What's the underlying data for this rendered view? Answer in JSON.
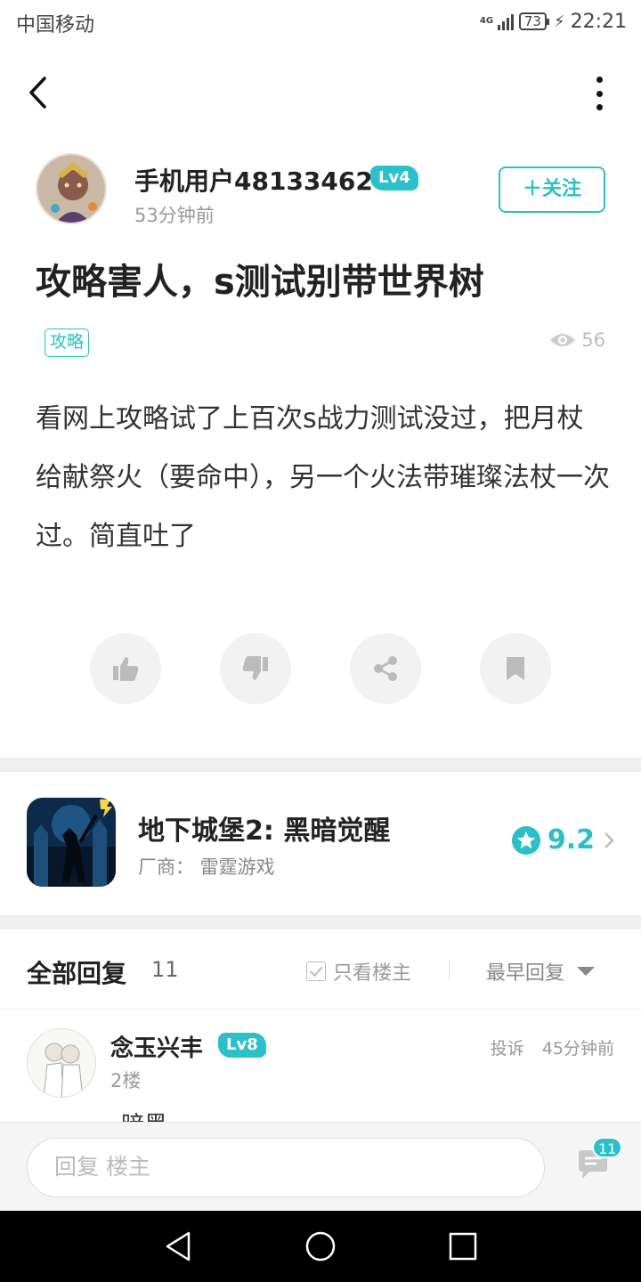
{
  "status_bar": {
    "carrier": "中国移动",
    "network": "4G",
    "battery": "73",
    "time": "22:21"
  },
  "post": {
    "author": {
      "name": "手机用户48133462",
      "level": "Lv4",
      "time": "53分钟前"
    },
    "follow_label": "＋关注",
    "title": "攻略害人，s测试别带世界树",
    "tag": "攻略",
    "views": "56",
    "body": "看网上攻略试了上百次s战力测试没过，把月杖给献祭火（要命中），另一个火法带璀璨法杖一次过。简直吐了"
  },
  "game": {
    "name": "地下城堡2: 黑暗觉醒",
    "vendor": "厂商：  雷霆游戏",
    "rating": "9.2"
  },
  "replies": {
    "title": "全部回复",
    "count": "11",
    "only_op_label": "只看楼主",
    "sort_label": "最早回复",
    "first": {
      "name": "念玉兴丰",
      "level": "Lv8",
      "floor": "2楼",
      "report": "投诉",
      "time": "45分钟前",
      "snippet": "暗黑"
    }
  },
  "reply_bar": {
    "placeholder": "回复  楼主",
    "badge": "11"
  },
  "colors": {
    "accent": "#2bbfc7",
    "text": "#222222",
    "muted": "#999999"
  },
  "icons": {
    "header": [
      "back-arrow-icon",
      "more-vert-icon"
    ],
    "actions": [
      "thumb-up-icon",
      "thumb-down-icon",
      "share-icon",
      "bookmark-icon"
    ],
    "misc": [
      "eye-icon",
      "star-icon",
      "chevron-right-icon",
      "checkbox-icon",
      "comment-icon"
    ]
  }
}
